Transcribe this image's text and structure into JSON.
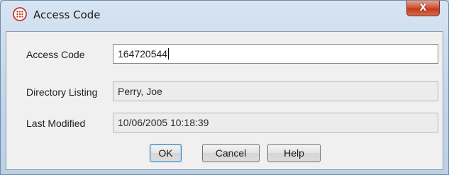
{
  "dialog": {
    "title": "Access Code",
    "close_label": "X"
  },
  "fields": [
    {
      "label": "Access Code",
      "value": "164720544",
      "editable": true
    },
    {
      "label": "Directory Listing",
      "value": "Perry, Joe",
      "editable": false
    },
    {
      "label": "Last Modified",
      "value": "10/06/2005 10:18:39",
      "editable": false
    }
  ],
  "buttons": {
    "ok": "OK",
    "cancel": "Cancel",
    "help": "Help"
  },
  "colors": {
    "title_icon": "#c0392b",
    "close_button": "#c23a1e",
    "default_button_border": "#3c7fb1"
  },
  "icons": {
    "title": "dialpad-icon",
    "close": "close-icon"
  }
}
